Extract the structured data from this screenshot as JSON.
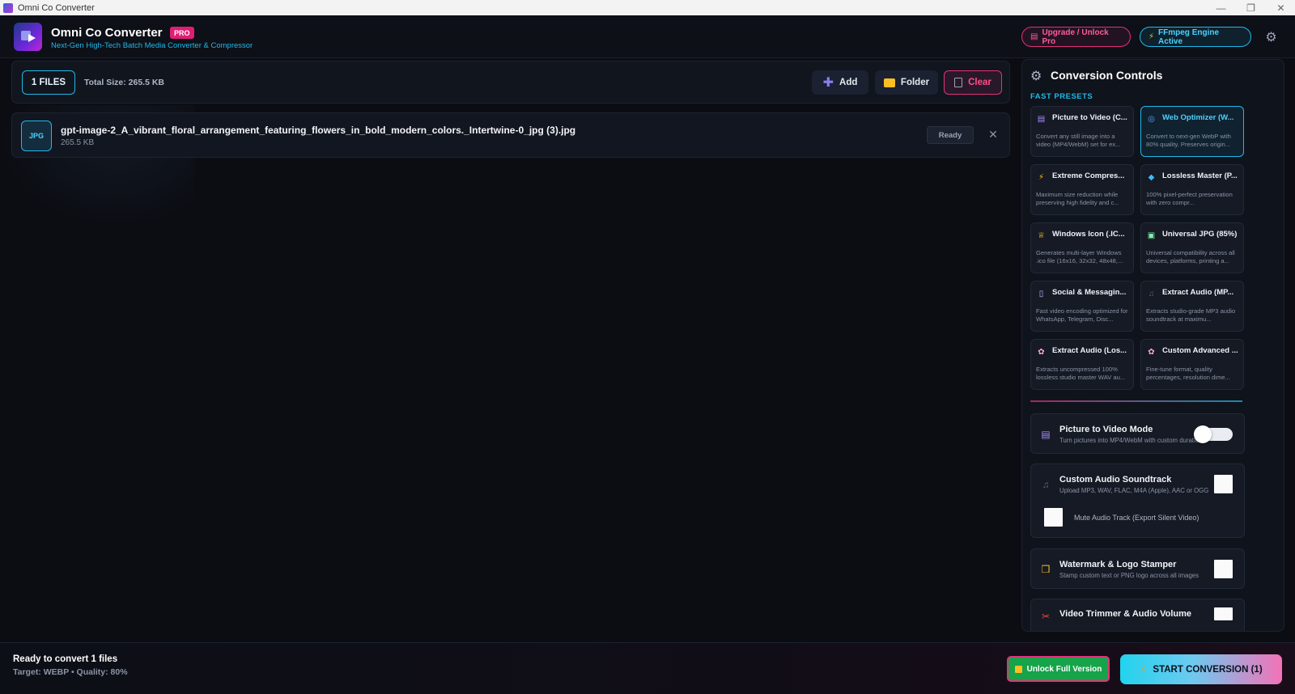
{
  "window": {
    "title": "Omni Co Converter"
  },
  "header": {
    "title": "Omni Co Converter",
    "badge": "PRO",
    "subtitle": "Next-Gen High-Tech Batch Media Converter & Compressor",
    "logo_text": "Omni Co",
    "upgrade_label": "Upgrade / Unlock Pro",
    "engine_label": "FFmpeg Engine Active"
  },
  "toolbar": {
    "files_count": "1 FILES",
    "total_size": "Total Size: 265.5 KB",
    "add_label": "Add",
    "folder_label": "Folder",
    "clear_label": "Clear"
  },
  "files": [
    {
      "type": "JPG",
      "name": "gpt-image-2_A_vibrant_floral_arrangement_featuring_flowers_in_bold_modern_colors._Intertwine-0_jpg (3).jpg",
      "size": "265.5 KB",
      "status": "Ready"
    }
  ],
  "controls": {
    "title": "Conversion Controls",
    "presets_heading": "FAST PRESETS",
    "presets": [
      {
        "title": "Picture to Video (C...",
        "desc": "Convert any still image into a video (MP4/WebM) set for ex...",
        "icon": "film-icon",
        "active": false
      },
      {
        "title": "Web Optimizer (W...",
        "desc": "Convert to next-gen WebP with 80% quality. Preserves origin...",
        "icon": "globe-icon",
        "active": true
      },
      {
        "title": "Extreme Compres...",
        "desc": "Maximum size reduction while preserving high fidelity and c...",
        "icon": "lightning-icon",
        "active": false
      },
      {
        "title": "Lossless Master (P...",
        "desc": "100% pixel-perfect preservation with zero compr...",
        "icon": "diamond-icon",
        "active": false
      },
      {
        "title": "Windows Icon (.IC...",
        "desc": "Generates multi-layer Windows .ico file (16x16, 32x32, 48x48,...",
        "icon": "crown-icon",
        "active": false
      },
      {
        "title": "Universal JPG (85%)",
        "desc": "Universal compatibility across all devices, platforms, printing a...",
        "icon": "picture-icon",
        "active": false
      },
      {
        "title": "Social & Messagin...",
        "desc": "Fast video encoding optimized for WhatsApp, Telegram, Disc...",
        "icon": "phone-icon",
        "active": false
      },
      {
        "title": "Extract Audio (MP...",
        "desc": "Extracts studio-grade MP3 audio soundtrack at maximu...",
        "icon": "music-note-icon",
        "active": false
      },
      {
        "title": "Extract Audio (Los...",
        "desc": "Extracts uncompressed 100% lossless studio master WAV au...",
        "icon": "palette-icon",
        "active": false
      },
      {
        "title": "Custom Advanced ...",
        "desc": "Fine-tune format, quality percentages, resolution dime...",
        "icon": "palette-icon",
        "active": false
      }
    ],
    "picture_to_video": {
      "title": "Picture to Video Mode",
      "sub": "Turn pictures into MP4/WebM with custom durations",
      "enabled": false
    },
    "custom_audio": {
      "title": "Custom Audio Soundtrack",
      "sub": "Upload MP3, WAV, FLAC, M4A (Apple), AAC or OGG",
      "mute_label": "Mute Audio Track (Export Silent Video)"
    },
    "watermark": {
      "title": "Watermark & Logo Stamper",
      "sub": "Stamp custom text or PNG logo across all images"
    },
    "trimmer": {
      "title": "Video Trimmer & Audio Volume"
    }
  },
  "footer": {
    "status": "Ready to convert 1 files",
    "target": "Target: WEBP • Quality: 80%",
    "unlock_label": "Unlock Full Version",
    "start_label": "START CONVERSION (1)"
  },
  "colors": {
    "accent_cyan": "#22b8e8",
    "accent_pink": "#e0327a",
    "unlock_green": "#16a34a",
    "background": "#0b0d13"
  }
}
